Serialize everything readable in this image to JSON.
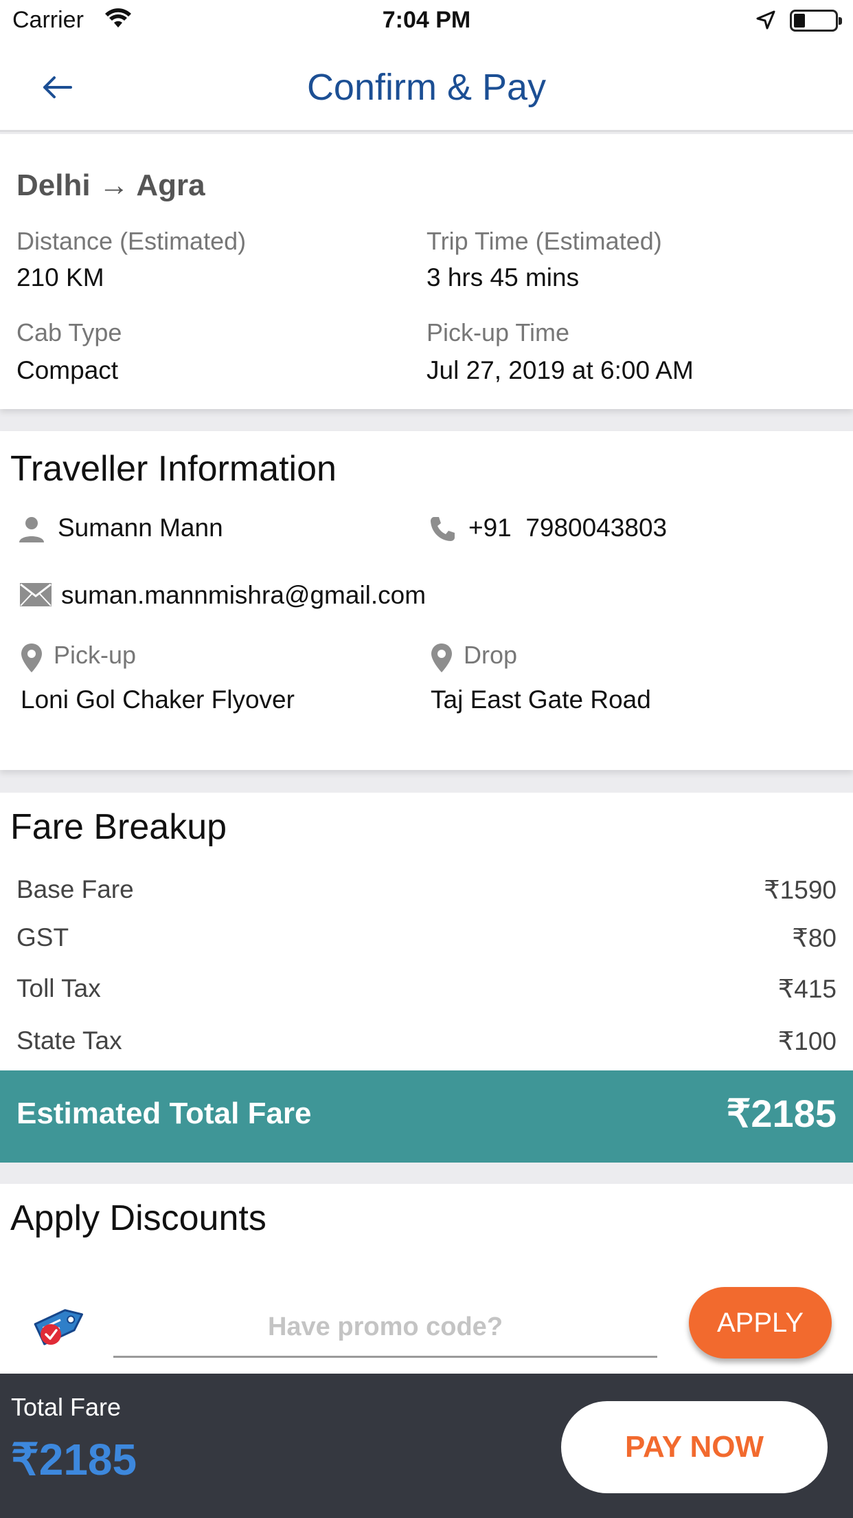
{
  "status_bar": {
    "carrier": "Carrier",
    "time": "7:04 PM"
  },
  "header": {
    "title": "Confirm & Pay",
    "back_icon": "arrow-left-icon"
  },
  "trip": {
    "from": "Delhi",
    "arrow": "→",
    "to": "Agra",
    "distance_label": "Distance (Estimated)",
    "distance_value": "210 KM",
    "trip_time_label": "Trip Time (Estimated)",
    "trip_time_value": "3 hrs 45 mins",
    "cab_type_label": "Cab Type",
    "cab_type_value": "Compact",
    "pickup_time_label": "Pick-up Time",
    "pickup_time_value": "Jul 27, 2019 at 6:00 AM"
  },
  "traveller": {
    "title": "Traveller Information",
    "name": "Sumann Mann",
    "phone_code": "+91",
    "phone_number": "7980043803",
    "email": "suman.mannmishra@gmail.com",
    "pickup_label": "Pick-up",
    "pickup_value": "Loni Gol Chaker Flyover",
    "drop_label": "Drop",
    "drop_value": "Taj East Gate Road"
  },
  "fare": {
    "title": "Fare Breakup",
    "rows": [
      {
        "name": "Base Fare",
        "amount": "₹1590"
      },
      {
        "name": "GST",
        "amount": "₹80"
      },
      {
        "name": "Toll Tax",
        "amount": "₹415"
      },
      {
        "name": "State Tax",
        "amount": "₹100"
      }
    ],
    "total_label": "Estimated Total Fare",
    "total_amount": "₹2185"
  },
  "discounts": {
    "title": "Apply Discounts",
    "promo_placeholder": "Have promo code?",
    "apply_label": "APPLY"
  },
  "footer": {
    "total_label": "Total Fare",
    "total_amount": "₹2185",
    "pay_label": "PAY NOW"
  },
  "colors": {
    "header_title": "#1c4f94",
    "total_band": "#3f9697",
    "apply_button": "#f26a2e",
    "footer_bg": "#353840",
    "footer_amount": "#3d88dd"
  }
}
